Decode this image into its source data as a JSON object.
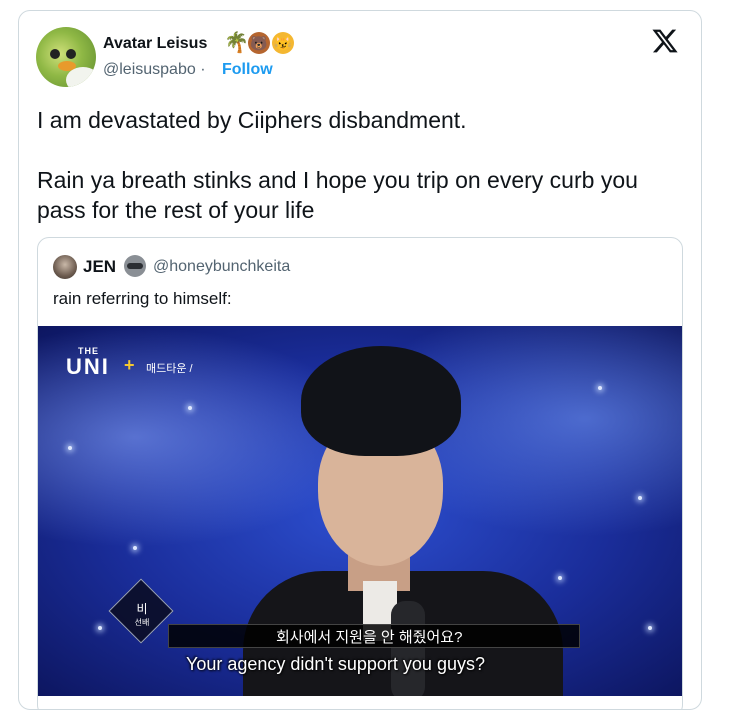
{
  "tweet": {
    "author_name": "Avatar Leisus",
    "author_emojis": [
      "🌴",
      "🐻",
      "😼"
    ],
    "handle": "@leisuspabo",
    "separator": "·",
    "follow_label": "Follow",
    "body_line1": "I am devastated by Ciiphers disbandment.",
    "body_line2": "Rain ya breath stinks and I hope you trip on every curb you pass for the rest of your life"
  },
  "quote": {
    "author_name": "JEN",
    "author_emoji": "raccoon-icon",
    "handle": "@honeybunchkeita",
    "text": "rain referring to himself:"
  },
  "media": {
    "logo_the": "THE",
    "logo_unit": "UNI",
    "logo_plus": "+",
    "logo_korean": "매드타운 /",
    "badge_name": "비",
    "badge_role": "선배",
    "korean_subtitle": "회사에서 지원을 안 해줬어요?",
    "english_subtitle": "Your agency didn't support you guys?"
  },
  "colors": {
    "link": "#1d9bf0",
    "text": "#0f1419",
    "muted": "#536471",
    "border": "#cfd9de"
  }
}
